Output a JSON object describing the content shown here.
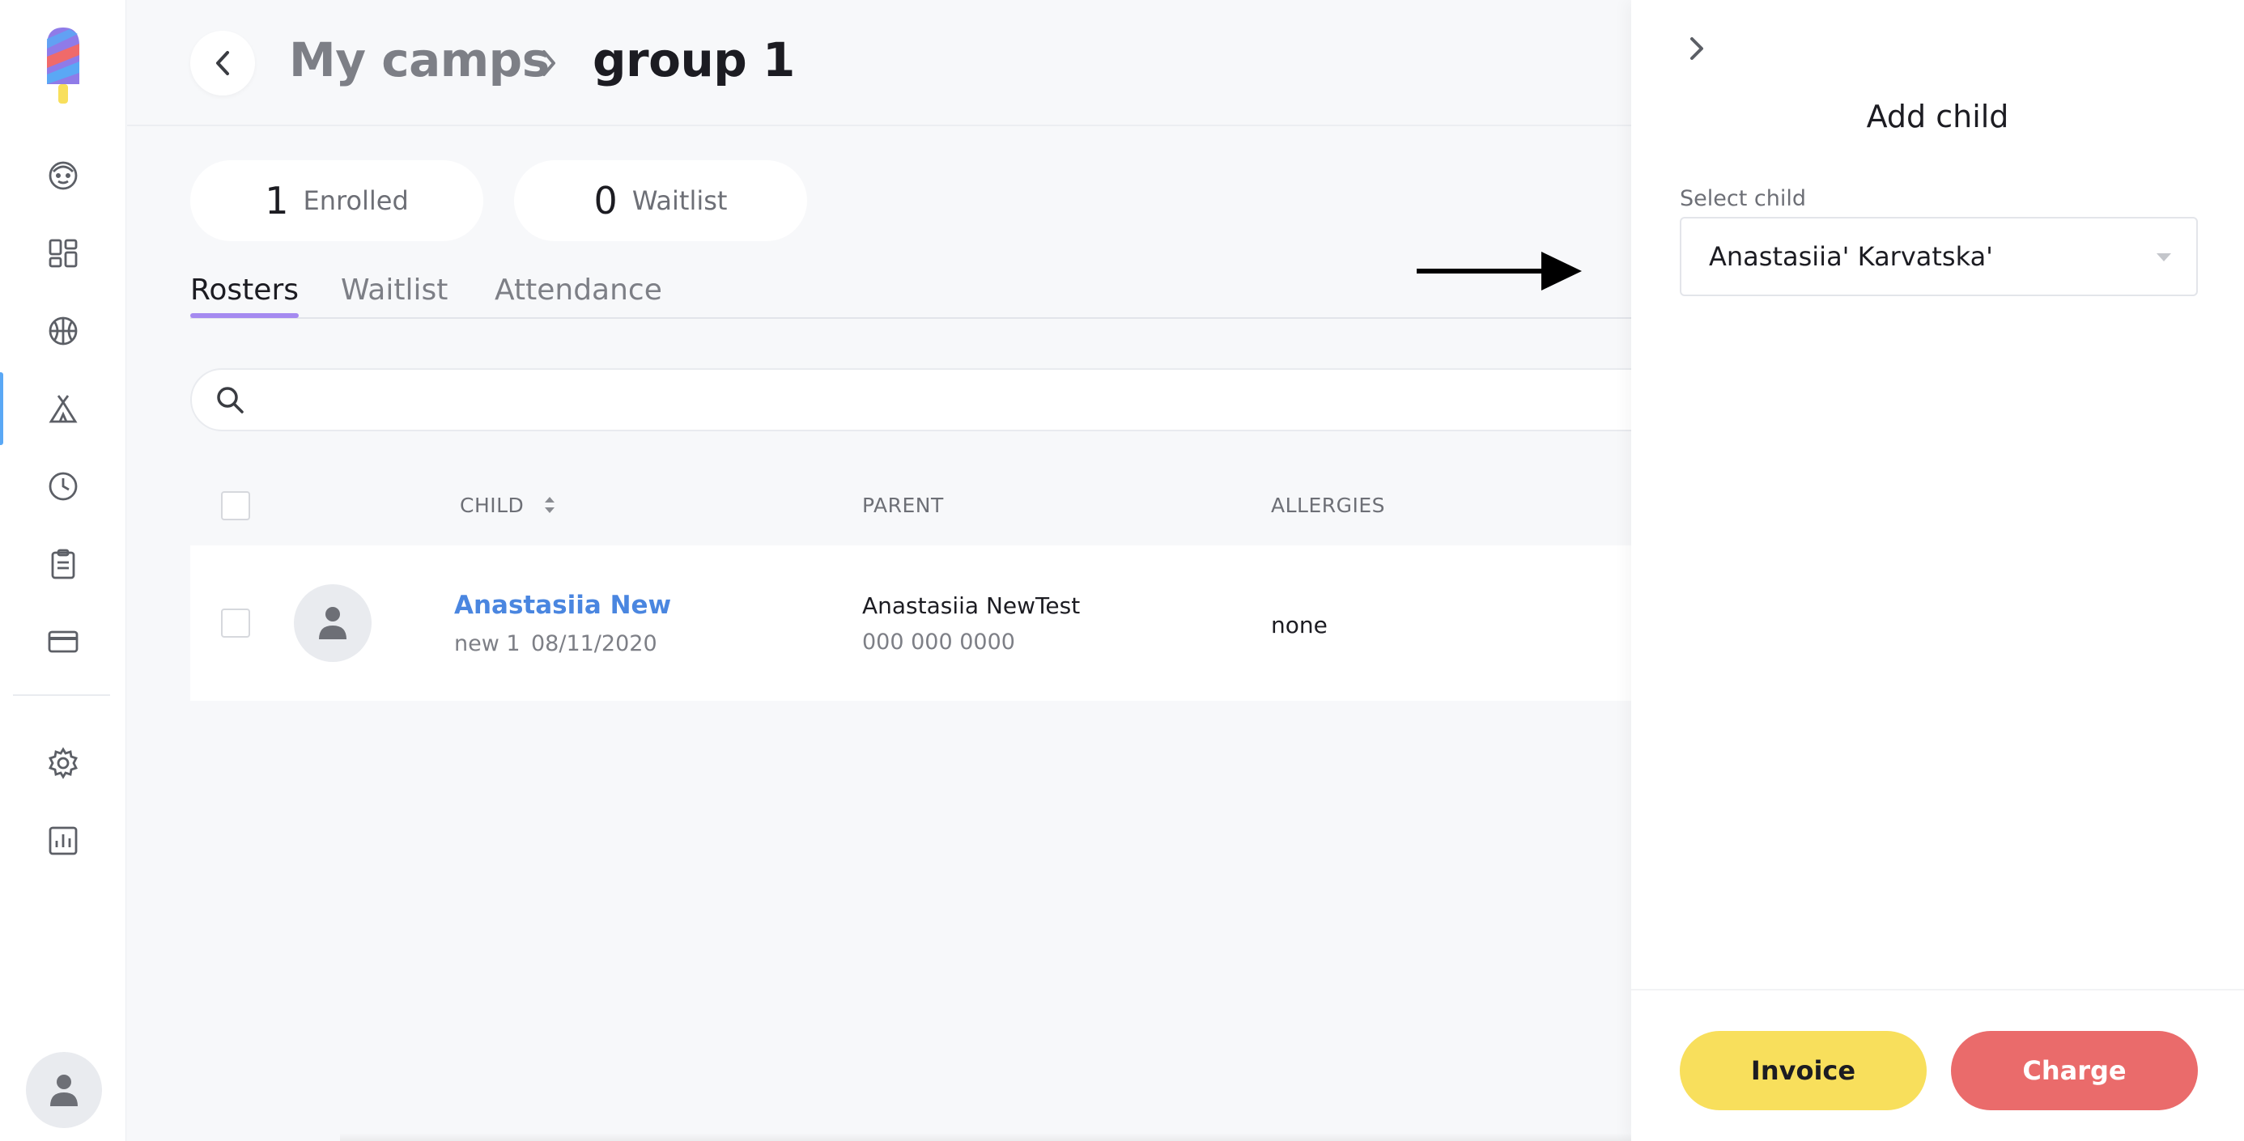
{
  "colors": {
    "accent_tab": "#a58af0",
    "link": "#4a86e0",
    "invoice": "#f8df5c",
    "charge": "#ea6b6b",
    "active_nav": "#5aa8f5"
  },
  "sidebar": {
    "items": [
      {
        "icon": "child-face-icon"
      },
      {
        "icon": "dashboard-grid-icon"
      },
      {
        "icon": "ball-icon"
      },
      {
        "icon": "tent-icon",
        "active": true
      },
      {
        "icon": "clock-icon"
      },
      {
        "icon": "clipboard-icon"
      },
      {
        "icon": "credit-card-icon"
      },
      {
        "icon": "gear-icon"
      },
      {
        "icon": "report-chart-icon"
      }
    ]
  },
  "header": {
    "parent": "My camps",
    "current": "group 1"
  },
  "stats": {
    "enrolled_count": "1",
    "enrolled_label": "Enrolled",
    "waitlist_count": "0",
    "waitlist_label": "Waitlist"
  },
  "tabs": [
    {
      "label": "Rosters",
      "active": true
    },
    {
      "label": "Waitlist"
    },
    {
      "label": "Attendance"
    }
  ],
  "search": {
    "placeholder": ""
  },
  "table": {
    "headers": {
      "child": "CHILD",
      "parent": "PARENT",
      "allergies": "ALLERGIES"
    },
    "rows": [
      {
        "child_name": "Anastasiia New",
        "group": "new 1",
        "dob": "08/11/2020",
        "parent_name": "Anastasiia NewTest",
        "parent_phone": "000 000 0000",
        "allergies": "none"
      }
    ]
  },
  "drawer": {
    "title": "Add child",
    "select_label": "Select child",
    "select_value": "Anastasiia' Karvatska'",
    "invoice_label": "Invoice",
    "charge_label": "Charge"
  }
}
